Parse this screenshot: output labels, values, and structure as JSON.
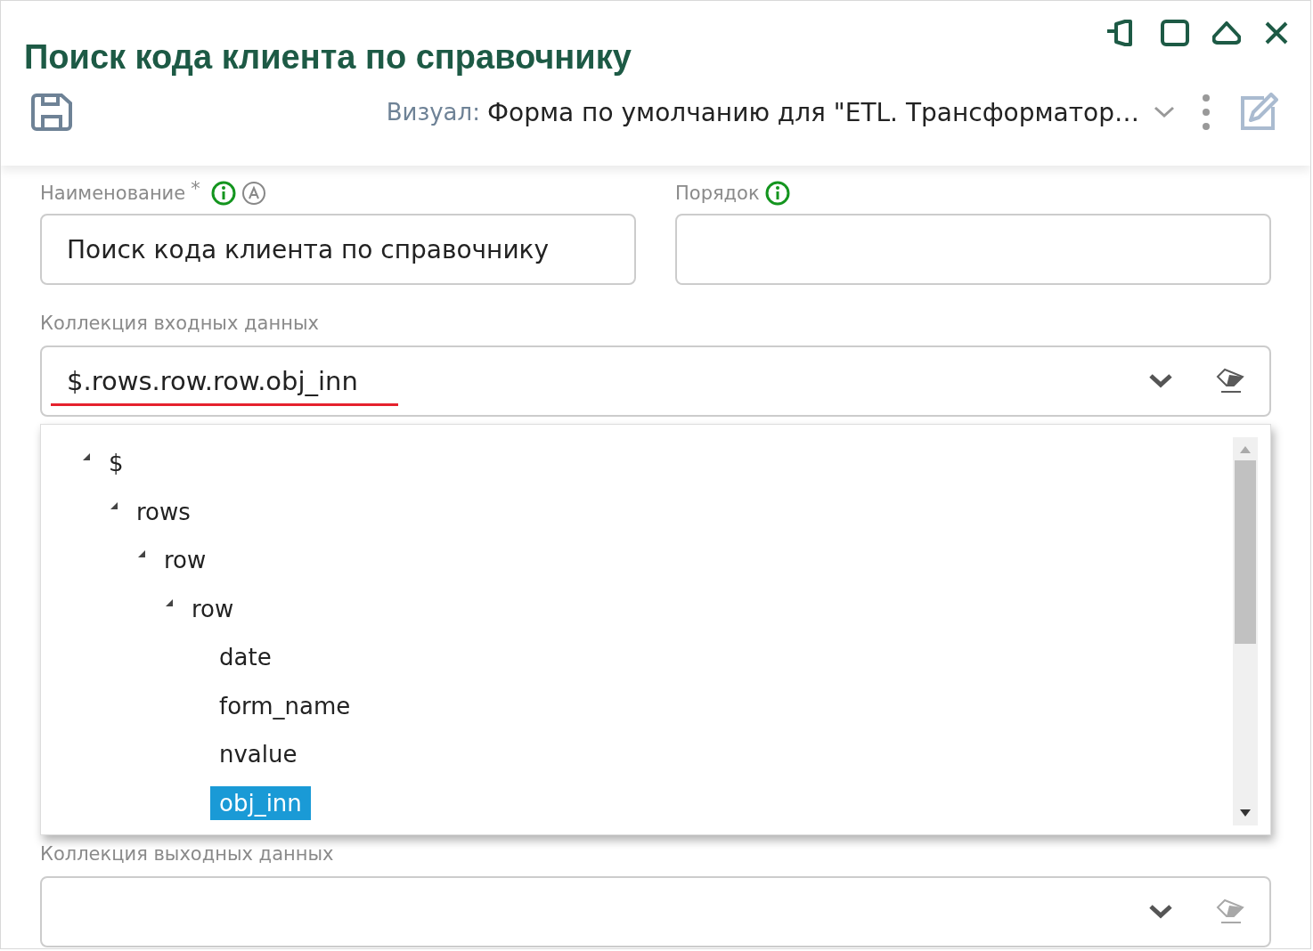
{
  "window": {
    "title": "Поиск кода клиента по справочнику"
  },
  "toolbar": {
    "visual_label": "Визуал:",
    "visual_value": "Форма по умолчанию для \"ETL. Трансформатор…"
  },
  "fields": [
    {
      "label": "Наименование",
      "required_mark": "*",
      "info": true,
      "auto": true,
      "value": "Поиск кода клиента по справочнику"
    },
    {
      "label": "Порядок",
      "info": true,
      "auto": false
    }
  ],
  "input_collection": {
    "label": "Коллекция входных данных",
    "value": "$.rows.row.row.obj_inn",
    "error": true,
    "clear_disabled": false
  },
  "tree": [
    {
      "label": "$",
      "expanded": true,
      "selected": false,
      "children": [
        {
          "label": "rows",
          "expanded": true,
          "selected": false,
          "children": [
            {
              "label": "row",
              "expanded": true,
              "selected": false,
              "children": [
                {
                  "label": "row",
                  "expanded": true,
                  "selected": false,
                  "children": [
                    {
                      "label": "date",
                      "selected": false
                    },
                    {
                      "label": "form_name",
                      "selected": false
                    },
                    {
                      "label": "nvalue",
                      "selected": false
                    },
                    {
                      "label": "obj_inn",
                      "selected": true
                    }
                  ]
                }
              ]
            }
          ]
        }
      ]
    }
  ],
  "output_collection": {
    "label": "Коллекция выходных данных",
    "error": false,
    "clear_disabled": true
  }
}
